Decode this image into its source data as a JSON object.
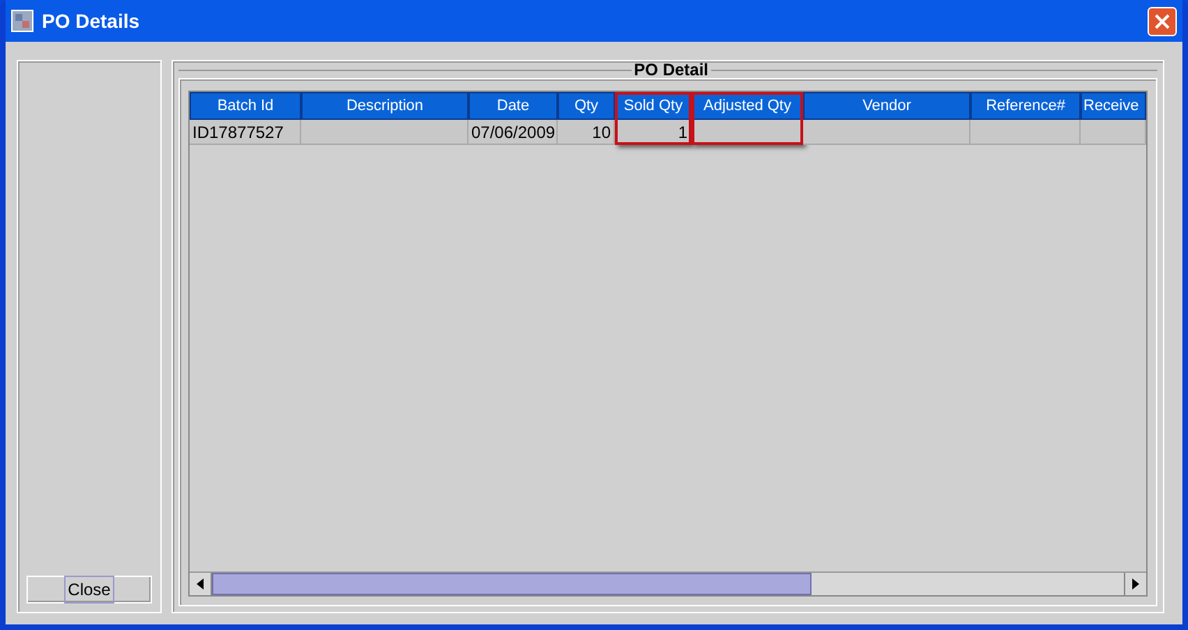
{
  "window": {
    "title": "PO Details"
  },
  "close_button": {
    "label": "Close"
  },
  "panel": {
    "title": "PO Detail"
  },
  "table": {
    "columns": [
      {
        "label": "Batch Id",
        "highlighted": false
      },
      {
        "label": "Description",
        "highlighted": false
      },
      {
        "label": "Date",
        "highlighted": false
      },
      {
        "label": "Qty",
        "highlighted": false
      },
      {
        "label": "Sold Qty",
        "highlighted": true
      },
      {
        "label": "Adjusted Qty",
        "highlighted": true
      },
      {
        "label": "Vendor",
        "highlighted": false
      },
      {
        "label": "Reference#",
        "highlighted": false
      },
      {
        "label": "Receive",
        "highlighted": false
      }
    ],
    "rows": [
      [
        "ID17877527",
        "",
        "07/06/2009",
        "10",
        "1",
        "",
        "",
        "",
        ""
      ]
    ]
  }
}
